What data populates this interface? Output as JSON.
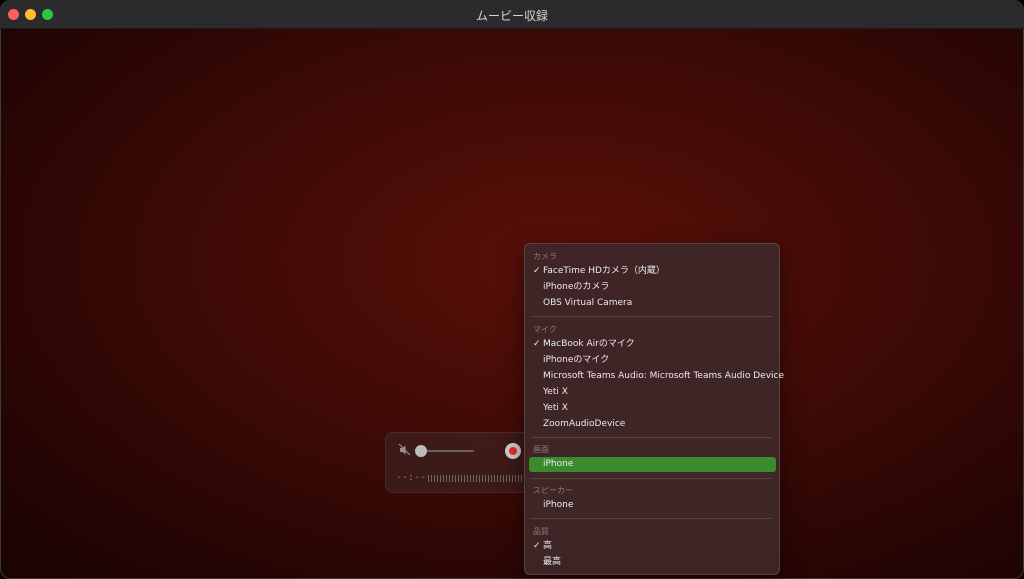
{
  "window": {
    "title": "ムービー収録"
  },
  "controller": {
    "time": "--:--",
    "mute_icon": "speaker-muted-icon",
    "record_icon": "record-icon"
  },
  "menu": {
    "sections": [
      {
        "title": "カメラ",
        "items": [
          {
            "label": "FaceTime HDカメラ（内蔵）",
            "checked": true
          },
          {
            "label": "iPhoneのカメラ",
            "checked": false
          },
          {
            "label": "OBS Virtual Camera",
            "checked": false
          }
        ]
      },
      {
        "title": "マイク",
        "items": [
          {
            "label": "MacBook Airのマイク",
            "checked": true
          },
          {
            "label": "iPhoneのマイク",
            "checked": false
          },
          {
            "label": "Microsoft Teams Audio: Microsoft Teams Audio Device",
            "checked": false
          },
          {
            "label": "Yeti X",
            "checked": false
          },
          {
            "label": "Yeti X",
            "checked": false
          },
          {
            "label": "ZoomAudioDevice",
            "checked": false
          }
        ]
      },
      {
        "title": "画面",
        "items": [
          {
            "label": "iPhone",
            "checked": false,
            "highlighted": true
          }
        ]
      },
      {
        "title": "スピーカー",
        "items": [
          {
            "label": "iPhone",
            "checked": false
          }
        ]
      },
      {
        "title": "品質",
        "items": [
          {
            "label": "高",
            "checked": true
          },
          {
            "label": "最高",
            "checked": false
          }
        ]
      }
    ],
    "check_mark": "✓",
    "highlight_color": "#3c8a2e"
  }
}
